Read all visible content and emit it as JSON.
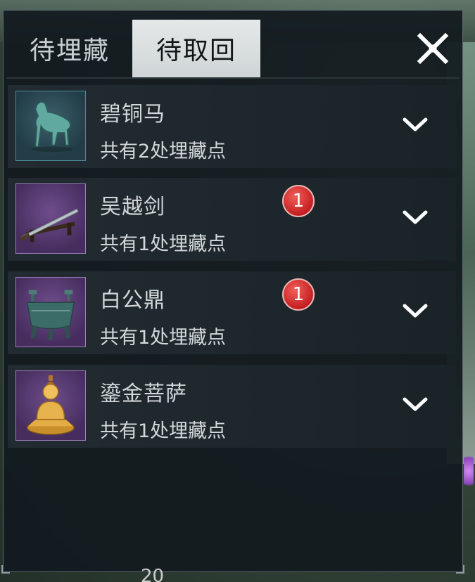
{
  "tabs": {
    "to_bury": "待埋藏",
    "to_retrieve": "待取回",
    "active": "to_retrieve"
  },
  "close_icon": "close-x-icon",
  "items": [
    {
      "name": "碧铜马",
      "subtitle": "共有2处埋藏点",
      "badge": null,
      "icon": "bronze-horse-icon",
      "expand_icon": "chevron-down-icon"
    },
    {
      "name": "吴越剑",
      "subtitle": "共有1处埋藏点",
      "badge": "1",
      "icon": "sword-icon",
      "expand_icon": "chevron-down-icon"
    },
    {
      "name": "白公鼎",
      "subtitle": "共有1处埋藏点",
      "badge": "1",
      "icon": "ding-cauldron-icon",
      "expand_icon": "chevron-down-icon"
    },
    {
      "name": "鎏金菩萨",
      "subtitle": "共有1处埋藏点",
      "badge": null,
      "icon": "golden-buddha-icon",
      "expand_icon": "chevron-down-icon"
    }
  ],
  "background_counter": "20",
  "colors": {
    "active_tab_bg": "#d9dfe0",
    "badge_red": "#d22a2a",
    "panel_bg": "#121a1f"
  }
}
